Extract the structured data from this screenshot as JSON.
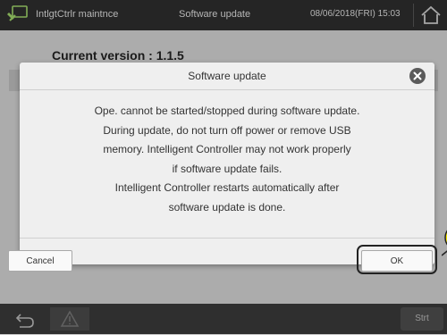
{
  "header": {
    "app_title": "IntlgtCtrlr maintnce",
    "screen_title": "Software update",
    "datetime": "08/06/2018(FRI) 15:03"
  },
  "main": {
    "current_version": "Current version : 1.1.5"
  },
  "dialog": {
    "title": "Software update",
    "message_lines": [
      "Ope. cannot be started/stopped during software update.",
      "During update, do not turn off power or remove USB",
      "memory. Intelligent Controller may not work properly",
      "if software update fails.",
      "Intelligent Controller restarts automatically after",
      "software update is done."
    ],
    "cancel_label": "Cancel",
    "ok_label": "OK"
  },
  "footer": {
    "start_label": "Strt"
  },
  "colors": {
    "header_bg": "#2e2e2e",
    "dialog_bg": "#efefef",
    "highlight": "#222222",
    "callout": "#f5e400"
  }
}
